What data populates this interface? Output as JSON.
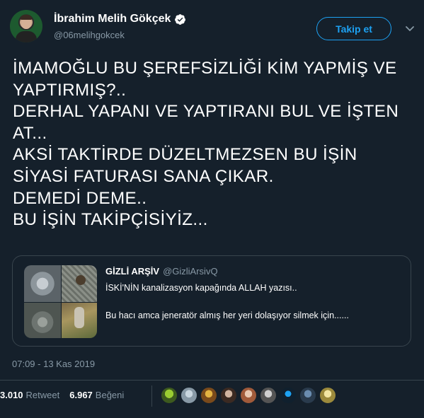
{
  "author": {
    "display_name": "İbrahim Melih Gökçek",
    "handle": "@06melihgokcek"
  },
  "actions": {
    "follow_label": "Takip et"
  },
  "tweet": {
    "lines": [
      "İMAMOĞLU BU ŞEREFSİZLİĞİ KİM YAPMİŞ VE",
      "YAPTIRMIŞ?..",
      "DERHAL YAPANI VE YAPTIRANI BUL VE İŞTEN",
      "AT...",
      "AKSİ TAKTİRDE DÜZELTMEZSEN BU İŞİN",
      "SİYASİ FATURASI SANA ÇIKAR.",
      "DEMEDİ DEME..",
      "BU İŞİN TAKİPÇİSİYİZ..."
    ]
  },
  "quoted_tweet": {
    "name": "GİZLİ ARŞİV",
    "handle": "@GizliArsivQ",
    "line1": "İSKİ'NİN kanalizasyon kapağında ALLAH yazısı..",
    "line2": "Bu hacı amca jeneratör almış her yeri dolaşıyor silmek için......"
  },
  "timestamp": "07:09 - 13 Kas 2019",
  "stats": {
    "retweets": "3.010",
    "retweets_label": "Retweet",
    "likes": "6.967",
    "likes_label": "Beğeni"
  },
  "colors": {
    "background": "#15202b",
    "accent": "#1da1f2",
    "secondary_text": "#8899a6",
    "border": "#38444d"
  },
  "icons": {
    "verified": "verified-badge-icon",
    "more": "chevron-down-icon"
  }
}
